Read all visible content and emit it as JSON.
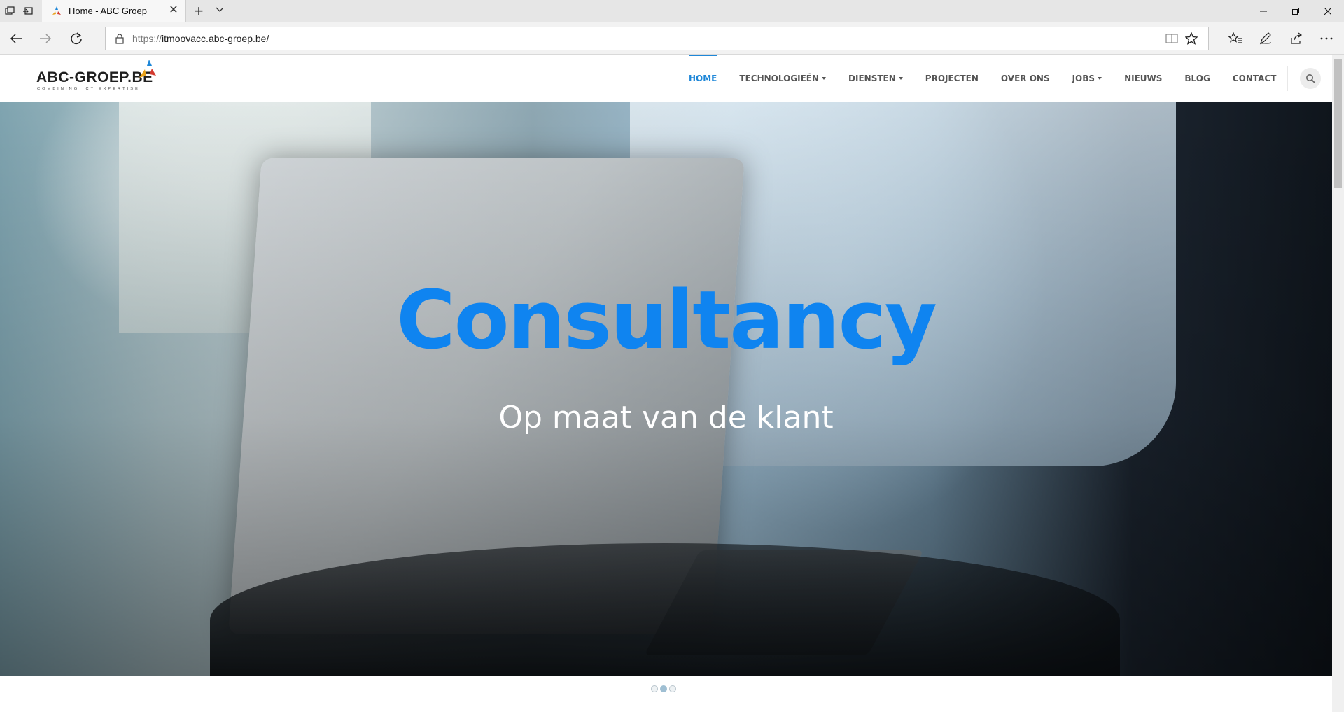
{
  "browser": {
    "tab": {
      "title": "Home - ABC Groep",
      "favicon": "abc-groep-favicon"
    },
    "tab_icons": [
      "tab-actions-icon",
      "set-tabs-aside-icon"
    ],
    "new_tab_icon": "plus-icon",
    "tab_list_icon": "chevron-down-icon",
    "window_controls": [
      "minimize-icon",
      "restore-icon",
      "close-icon"
    ],
    "address": {
      "scheme": "https://",
      "host": "itmoovacc.abc-groep.be/"
    },
    "nav_icons": [
      "back-arrow-icon",
      "forward-arrow-icon",
      "refresh-icon"
    ],
    "address_actions": [
      "reading-view-icon",
      "favorite-star-icon"
    ],
    "toolbar_icons": [
      "favorites-list-icon",
      "add-notes-icon",
      "share-icon",
      "more-dots-icon"
    ]
  },
  "site": {
    "logo": {
      "text": "ABC-GROEP.BE",
      "tagline": "COMBINING ICT EXPERTISE"
    },
    "nav": [
      {
        "label": "HOME",
        "active": true,
        "dropdown": false
      },
      {
        "label": "TECHNOLOGIEËN",
        "active": false,
        "dropdown": true
      },
      {
        "label": "DIENSTEN",
        "active": false,
        "dropdown": true
      },
      {
        "label": "PROJECTEN",
        "active": false,
        "dropdown": false
      },
      {
        "label": "OVER ONS",
        "active": false,
        "dropdown": false
      },
      {
        "label": "JOBS",
        "active": false,
        "dropdown": true
      },
      {
        "label": "NIEUWS",
        "active": false,
        "dropdown": false
      },
      {
        "label": "BLOG",
        "active": false,
        "dropdown": false
      },
      {
        "label": "CONTACT",
        "active": false,
        "dropdown": false
      }
    ],
    "search_icon": "search-icon",
    "accent_color": "#1e87d8"
  },
  "hero": {
    "title": "Consultancy",
    "subtitle": "Op maat van de klant",
    "title_color": "#0f84f0",
    "slide_count": 3,
    "active_slide": 2
  }
}
